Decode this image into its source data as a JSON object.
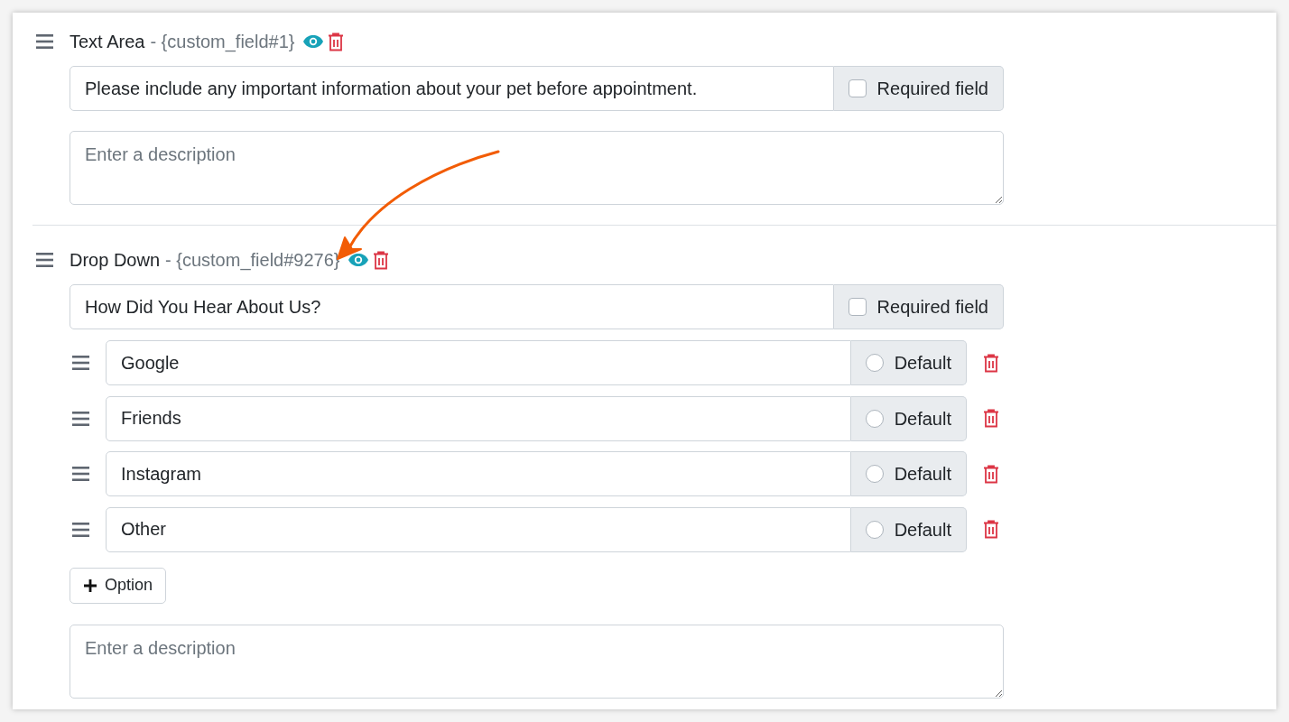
{
  "fields": [
    {
      "type": "Text Area",
      "token": "- {custom_field#1}",
      "label": "Please include any important information about your pet before appointment.",
      "required": false,
      "required_label": "Required field",
      "description_placeholder": "Enter a description"
    },
    {
      "type": "Drop Down",
      "token": "- {custom_field#9276}",
      "label": "How Did You Hear About Us?",
      "required": false,
      "required_label": "Required field",
      "options": [
        {
          "label": "Google",
          "default_label": "Default",
          "selected": false
        },
        {
          "label": "Friends",
          "default_label": "Default",
          "selected": false
        },
        {
          "label": "Instagram",
          "default_label": "Default",
          "selected": false
        },
        {
          "label": "Other",
          "default_label": "Default",
          "selected": false
        }
      ],
      "add_option_label": "Option",
      "description_placeholder": "Enter a description"
    }
  ]
}
